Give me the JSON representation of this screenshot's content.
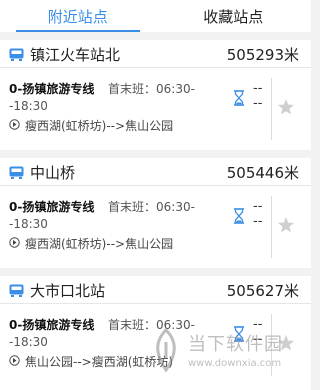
{
  "tabs": [
    {
      "label": "附近站点",
      "active": true
    },
    {
      "label": "收藏站点",
      "active": false
    }
  ],
  "stations": [
    {
      "name": "镇江火车站北",
      "distance": "505293米",
      "line": {
        "route_name": "0-扬镇旅游专线",
        "first_last_label": "首末班：06:30-",
        "end_time": "-18:30",
        "direction": "瘦西湖(虹桥坊)-->焦山公园",
        "eta": "--\n--"
      }
    },
    {
      "name": "中山桥",
      "distance": "505446米",
      "line": {
        "route_name": "0-扬镇旅游专线",
        "first_last_label": "首末班：06:30-",
        "end_time": "-18:30",
        "direction": "瘦西湖(虹桥坊)-->焦山公园",
        "eta": "--\n--"
      }
    },
    {
      "name": "大市口北站",
      "distance": "505627米",
      "line": {
        "route_name": "0-扬镇旅游专线",
        "first_last_label": "首末班：06:30-",
        "end_time": "-18:30",
        "direction": "焦山公园-->瘦西湖(虹桥坊)",
        "eta": "--\n--"
      }
    }
  ],
  "watermark": {
    "text": "当下软件园",
    "url": "www.downxia.com"
  },
  "colors": {
    "accent": "#3a8ee6",
    "bus_icon": "#3a8ee6",
    "hourglass": "#3a8ee6",
    "star": "#cfcfcf",
    "background": "#f2f2f2"
  },
  "icons": {
    "bus": "bus-icon",
    "hourglass": "hourglass-icon",
    "star": "star-icon",
    "direction": "direction-icon"
  }
}
